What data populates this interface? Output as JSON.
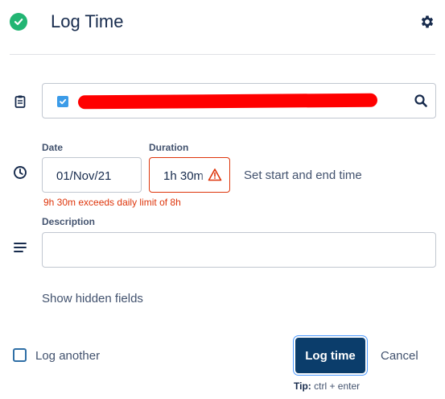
{
  "header": {
    "title": "Log Time"
  },
  "issue": {
    "selected_value": ""
  },
  "date": {
    "label": "Date",
    "value": "01/Nov/21"
  },
  "duration": {
    "label": "Duration",
    "value": "1h 30m",
    "error": "9h 30m exceeds daily limit of 8h"
  },
  "set_times_link": "Set start and end time",
  "description": {
    "label": "Description",
    "value": ""
  },
  "hidden_fields_link": "Show hidden fields",
  "footer": {
    "log_another_label": "Log another",
    "log_another_checked": false,
    "submit_label": "Log time",
    "cancel_label": "Cancel",
    "tip_prefix": "Tip:",
    "tip_text": " ctrl + enter"
  },
  "colors": {
    "success": "#22b573",
    "primary": "#0b3d6b",
    "error": "#de350b",
    "checkbox": "#3b9be8"
  },
  "icons": [
    "check-circle-icon",
    "gear-icon",
    "clipboard-icon",
    "search-icon",
    "clock-icon",
    "warning-icon",
    "lines-icon"
  ]
}
